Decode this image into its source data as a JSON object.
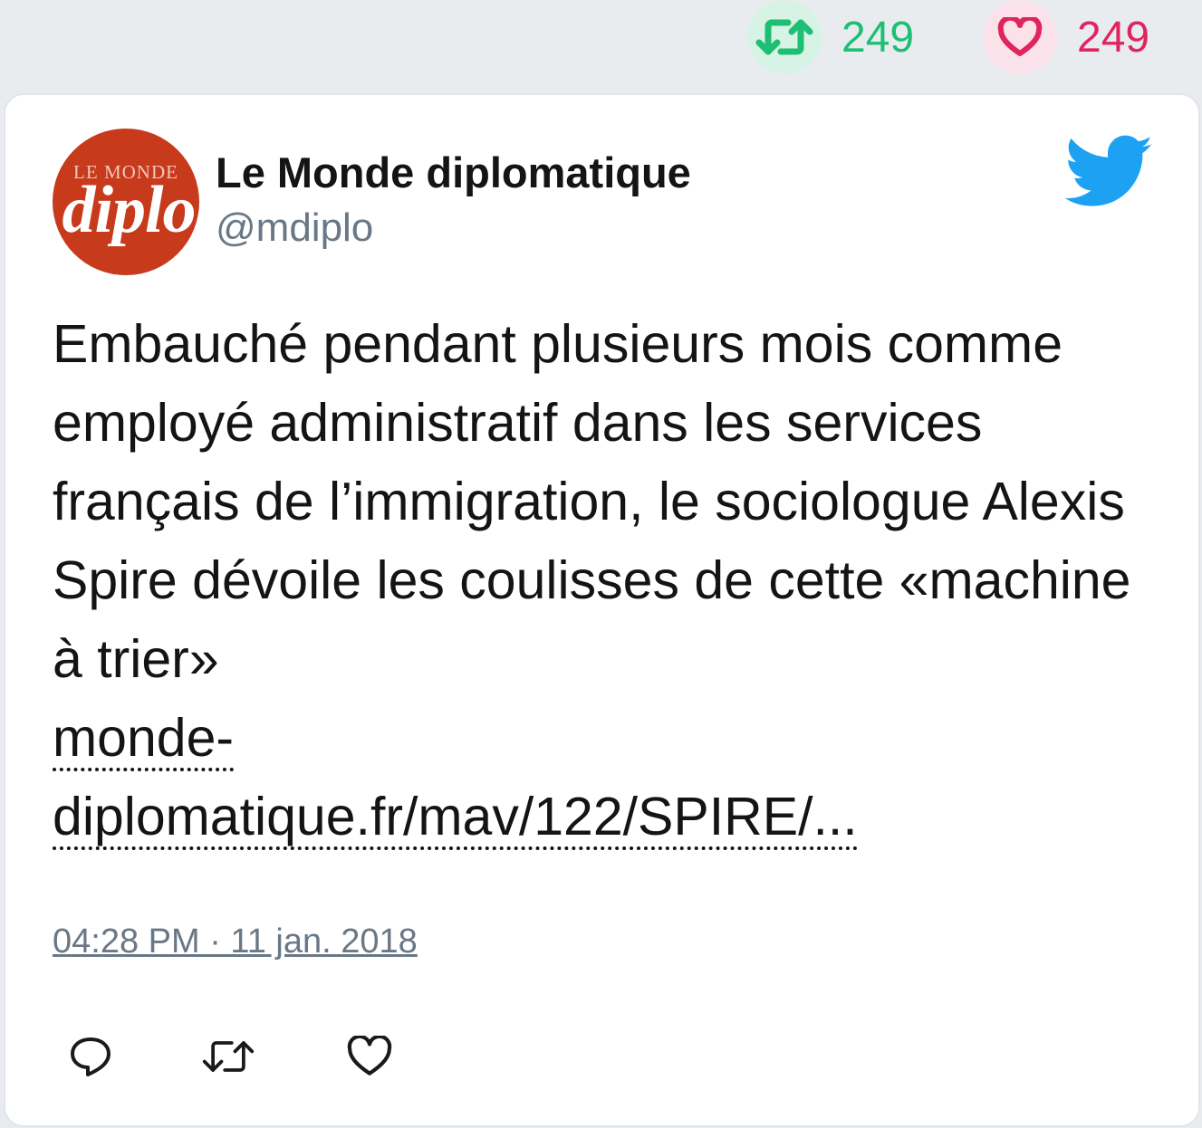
{
  "header_stats": {
    "retweet_count": "249",
    "like_count": "249",
    "retweet_icon": "retweet-icon",
    "like_icon": "heart-icon",
    "retweet_color": "#1dbf73",
    "like_color": "#e0245e"
  },
  "tweet": {
    "author_name": "Le Monde diplomatique",
    "author_handle": "@mdiplo",
    "avatar_text_small": "LE MONDE",
    "avatar_text_big": "diplo",
    "text": "Embauché pendant plusieurs mois comme employé administratif dans les services français de l’immigration, le sociologue Alexis Spire dévoile les coulisses de cette «machine à trier»",
    "link_part1": "monde-",
    "link_part2": "diplomatique.fr/mav/122/SPIRE/...",
    "timestamp": "04:28 PM · 11 jan. 2018",
    "brand_icon": "twitter-bird-icon",
    "brand_color": "#1da1f2"
  },
  "actions": {
    "reply_icon": "reply-icon",
    "retweet_icon": "retweet-icon",
    "like_icon": "heart-icon"
  }
}
